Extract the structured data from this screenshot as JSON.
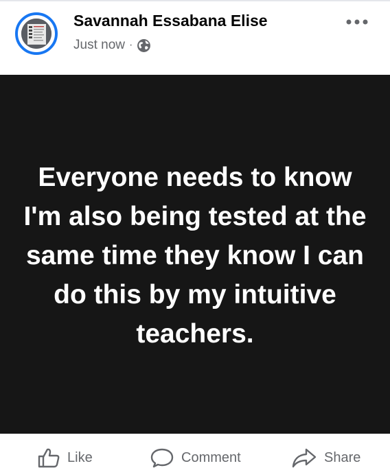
{
  "post": {
    "author": "Savannah Essabana Elise",
    "timestamp": "Just now",
    "separator": "·",
    "privacy_icon": "globe-icon",
    "text": "Everyone needs to know I'm also being tested at the same time they know I can do this by my intuitive teachers."
  },
  "actions": {
    "like_label": "Like",
    "comment_label": "Comment",
    "share_label": "Share"
  },
  "colors": {
    "avatar_ring": "#1877f2",
    "post_background": "#161616",
    "secondary_text": "#65676b"
  }
}
